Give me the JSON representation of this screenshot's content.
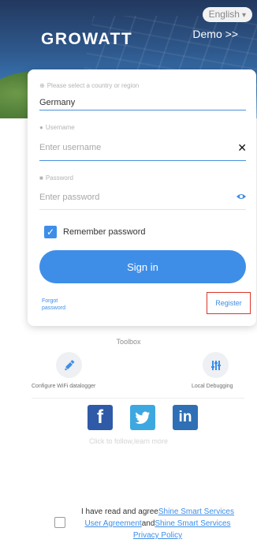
{
  "header": {
    "language": "English",
    "logo": "GROWATT",
    "demo_link": "Demo >>"
  },
  "login": {
    "region_placeholder": "Please select a country or region",
    "region_value": "Germany",
    "username_label": "Username",
    "username_placeholder": "Enter username",
    "password_label": "Password",
    "password_placeholder": "Enter password",
    "remember_label": "Remember password",
    "remember_checked": true,
    "signin_label": "Sign in",
    "forgot_label": "Forgot password",
    "register_label": "Register"
  },
  "toolbox": {
    "title": "Toolbox",
    "items": [
      {
        "label": "Configure WiFi datalogger",
        "icon": "wifi-config-icon"
      },
      {
        "label": "Local Debugging",
        "icon": "debug-sliders-icon"
      }
    ]
  },
  "social": {
    "icons": [
      "facebook-icon",
      "twitter-icon",
      "linkedin-icon"
    ],
    "follow_text": "Click to follow,learn more"
  },
  "agreement": {
    "prefix": "I have read and agree",
    "link1": "Shine Smart Services User Agreement",
    "and": "and",
    "link2": "Shine Smart Services Privacy Policy"
  },
  "colors": {
    "primary": "#3e8ee8",
    "register_border": "#d9362b",
    "header_dark": "#22385e"
  }
}
